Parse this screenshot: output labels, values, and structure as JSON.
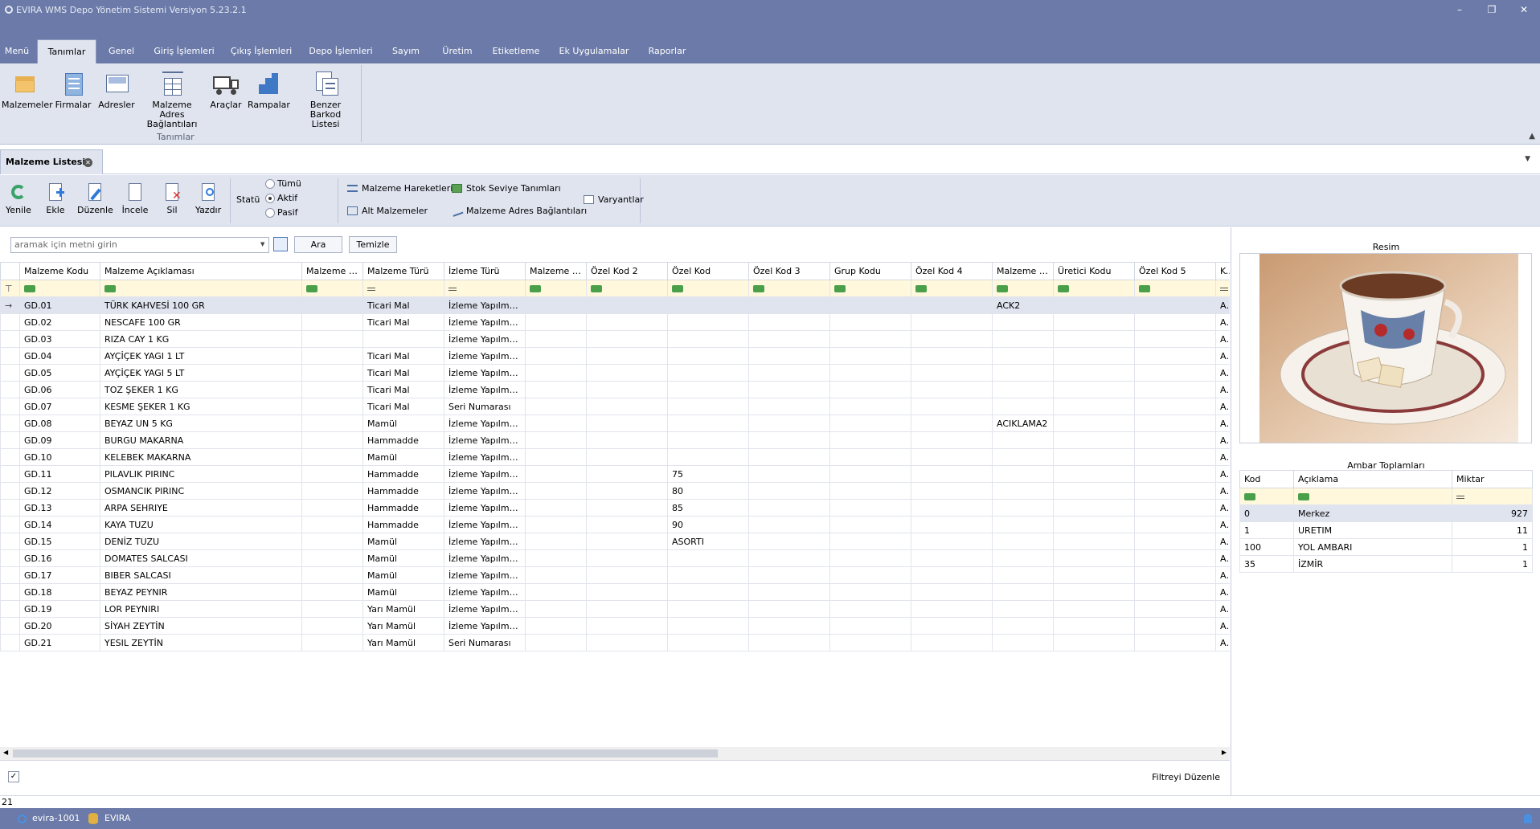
{
  "window": {
    "title": "EVIRA WMS Depo Yönetim Sistemi  Versiyon 5.23.2.1",
    "min": "–",
    "restore": "❐",
    "close": "✕"
  },
  "menu": [
    "Menü",
    "Tanımlar",
    "Genel",
    "Giriş İşlemleri",
    "Çıkış İşlemleri",
    "Depo İşlemleri",
    "Sayım",
    "Üretim",
    "Etiketleme",
    "Ek Uygulamalar",
    "Raporlar"
  ],
  "ribbon": {
    "group": "Tanımlar",
    "buttons": [
      {
        "l1": "Malzemeler",
        "l2": "",
        "icon": "box-icon"
      },
      {
        "l1": "Firmalar",
        "l2": "",
        "icon": "building-icon"
      },
      {
        "l1": "Adresler",
        "l2": "",
        "icon": "address-icon"
      },
      {
        "l1": "Malzeme Adres",
        "l2": "Bağlantıları",
        "icon": "link-grid-icon"
      },
      {
        "l1": "Araçlar",
        "l2": "",
        "icon": "truck-icon"
      },
      {
        "l1": "Rampalar",
        "l2": "",
        "icon": "ramp-icon"
      },
      {
        "l1": "Benzer Barkod",
        "l2": "Listesi",
        "icon": "barcode-list-icon"
      }
    ]
  },
  "doc_tab": "Malzeme Listesi",
  "toolbar": {
    "buttons": [
      "Yenile",
      "Ekle",
      "Düzenle",
      "İncele",
      "Sil",
      "Yazdır"
    ],
    "status_label": "Statü",
    "radios": [
      "Tümü",
      "Aktif",
      "Pasif"
    ],
    "selected_radio": "Aktif",
    "links": [
      "Malzeme Hareketleri",
      "Alt Malzemeler",
      "Stok Seviye Tanımları",
      "Malzeme Adres Bağlantıları",
      "Varyantlar"
    ]
  },
  "search": {
    "placeholder": "aramak için metni girin",
    "find": "Ara",
    "clear": "Temizle"
  },
  "grid": {
    "columns": [
      "Malzeme Kodu",
      "Malzeme Açıklaması",
      "Malzeme A...",
      "Malzeme Türü",
      "İzleme Türü",
      "Malzeme A...",
      "Özel Kod 2",
      "Özel Kod",
      "Özel Kod 3",
      "Grup Kodu",
      "Özel Kod 4",
      "Malzeme A...",
      "Üretici Kodu",
      "Özel Kod 5",
      "Kulla"
    ],
    "filter_types": [
      "t",
      "t",
      "t",
      "e",
      "e",
      "t",
      "t",
      "t",
      "t",
      "t",
      "t",
      "t",
      "t",
      "t",
      "e"
    ],
    "rows": [
      [
        "GD.01",
        "TÜRK KAHVESİ 100 GR",
        "",
        "Ticari Mal",
        "İzleme Yapılmay...",
        "",
        "",
        "",
        "",
        "",
        "",
        "ACK2",
        "",
        "",
        "Aktif"
      ],
      [
        "GD.02",
        "NESCAFE 100 GR",
        "",
        "Ticari Mal",
        "İzleme Yapılmay...",
        "",
        "",
        "",
        "",
        "",
        "",
        "",
        "",
        "",
        "Aktif"
      ],
      [
        "GD.03",
        "RIZA CAY 1 KG",
        "",
        "",
        "İzleme Yapılmay...",
        "",
        "",
        "",
        "",
        "",
        "",
        "",
        "",
        "",
        "Aktif"
      ],
      [
        "GD.04",
        "AYÇİÇEK YAGI 1 LT",
        "",
        "Ticari Mal",
        "İzleme Yapılmay...",
        "",
        "",
        "",
        "",
        "",
        "",
        "",
        "",
        "",
        "Aktif"
      ],
      [
        "GD.05",
        "AYÇİÇEK YAGI 5 LT",
        "",
        "Ticari Mal",
        "İzleme Yapılmay...",
        "",
        "",
        "",
        "",
        "",
        "",
        "",
        "",
        "",
        "Aktif"
      ],
      [
        "GD.06",
        "TOZ ŞEKER 1 KG",
        "",
        "Ticari Mal",
        "İzleme Yapılmay...",
        "",
        "",
        "",
        "",
        "",
        "",
        "",
        "",
        "",
        "Aktif"
      ],
      [
        "GD.07",
        "KESME ŞEKER 1 KG",
        "",
        "Ticari Mal",
        "Seri Numarası",
        "",
        "",
        "",
        "",
        "",
        "",
        "",
        "",
        "",
        "Aktif"
      ],
      [
        "GD.08",
        "BEYAZ UN 5 KG",
        "",
        "Mamül",
        "İzleme Yapılmay...",
        "",
        "",
        "",
        "",
        "",
        "",
        "ACIKLAMA2",
        "",
        "",
        "Aktif"
      ],
      [
        "GD.09",
        "BURGU MAKARNA",
        "",
        "Hammadde",
        "İzleme Yapılmay...",
        "",
        "",
        "",
        "",
        "",
        "",
        "",
        "",
        "",
        "Aktif"
      ],
      [
        "GD.10",
        "KELEBEK MAKARNA",
        "",
        "Mamül",
        "İzleme Yapılmay...",
        "",
        "",
        "",
        "",
        "",
        "",
        "",
        "",
        "",
        "Aktif"
      ],
      [
        "GD.11",
        "PILAVLIK PIRINC",
        "",
        "Hammadde",
        "İzleme Yapılmay...",
        "",
        "",
        "75",
        "",
        "",
        "",
        "",
        "",
        "",
        "Aktif"
      ],
      [
        "GD.12",
        "OSMANCIK PIRINC",
        "",
        "Hammadde",
        "İzleme Yapılmay...",
        "",
        "",
        "80",
        "",
        "",
        "",
        "",
        "",
        "",
        "Aktif"
      ],
      [
        "GD.13",
        "ARPA SEHRIYE",
        "",
        "Hammadde",
        "İzleme Yapılmay...",
        "",
        "",
        "85",
        "",
        "",
        "",
        "",
        "",
        "",
        "Aktif"
      ],
      [
        "GD.14",
        "KAYA TUZU",
        "",
        "Hammadde",
        "İzleme Yapılmay...",
        "",
        "",
        "90",
        "",
        "",
        "",
        "",
        "",
        "",
        "Aktif"
      ],
      [
        "GD.15",
        "DENİZ TUZU",
        "",
        "Mamül",
        "İzleme Yapılmay...",
        "",
        "",
        "ASORTI",
        "",
        "",
        "",
        "",
        "",
        "",
        "Aktif"
      ],
      [
        "GD.16",
        "DOMATES SALCASI",
        "",
        "Mamül",
        "İzleme Yapılmay...",
        "",
        "",
        "",
        "",
        "",
        "",
        "",
        "",
        "",
        "Aktif"
      ],
      [
        "GD.17",
        "BIBER SALCASI",
        "",
        "Mamül",
        "İzleme Yapılmay...",
        "",
        "",
        "",
        "",
        "",
        "",
        "",
        "",
        "",
        "Aktif"
      ],
      [
        "GD.18",
        "BEYAZ PEYNIR",
        "",
        "Mamül",
        "İzleme Yapılmay...",
        "",
        "",
        "",
        "",
        "",
        "",
        "",
        "",
        "",
        "Aktif"
      ],
      [
        "GD.19",
        "LOR PEYNIRI",
        "",
        "Yarı Mamül",
        "İzleme Yapılmay...",
        "",
        "",
        "",
        "",
        "",
        "",
        "",
        "",
        "",
        "Aktif"
      ],
      [
        "GD.20",
        "SİYAH ZEYTİN",
        "",
        "Yarı Mamül",
        "İzleme Yapılmay...",
        "",
        "",
        "",
        "",
        "",
        "",
        "",
        "",
        "",
        "Aktif"
      ],
      [
        "GD.21",
        "YESIL ZEYTİN",
        "",
        "Yarı Mamül",
        "Seri Numarası",
        "",
        "",
        "",
        "",
        "",
        "",
        "",
        "",
        "",
        "Aktif"
      ]
    ],
    "footer_filter": "Filtreyi Düzenle",
    "row_count": "21"
  },
  "right": {
    "image_label": "Resim",
    "image_icon": "coffee-cup-photo",
    "wh_title": "Ambar Toplamları",
    "wh_columns": [
      "Kod",
      "Açıklama",
      "Miktar"
    ],
    "wh_rows": [
      [
        "0",
        "Merkez",
        "927"
      ],
      [
        "1",
        "URETIM",
        "11"
      ],
      [
        "100",
        "YOL AMBARI",
        "1"
      ],
      [
        "35",
        "İZMİR",
        "1"
      ]
    ]
  },
  "statusbar": {
    "user": "evira-1001",
    "db": "EVIRA"
  },
  "colors": {
    "title_bar": "#6b7aa8",
    "ribbon": "#dfe4ef",
    "filter_row": "#fff8dc",
    "selected_row": "#dfe4ef"
  }
}
